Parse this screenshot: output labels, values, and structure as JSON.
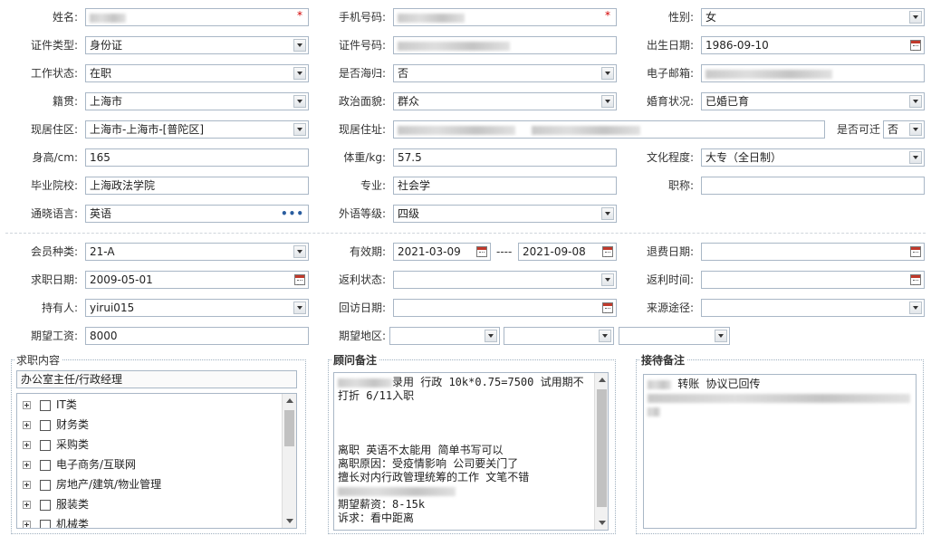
{
  "form": {
    "name": {
      "label": "姓名:"
    },
    "phone": {
      "label": "手机号码:"
    },
    "gender": {
      "label": "性别:",
      "value": "女"
    },
    "id_type": {
      "label": "证件类型:",
      "value": "身份证"
    },
    "id_no": {
      "label": "证件号码:"
    },
    "birth": {
      "label": "出生日期:",
      "value": "1986-09-10"
    },
    "work_status": {
      "label": "工作状态:",
      "value": "在职"
    },
    "overseas": {
      "label": "是否海归:",
      "value": "否"
    },
    "email": {
      "label": "电子邮箱:"
    },
    "native": {
      "label": "籍贯:",
      "value": "上海市"
    },
    "politics": {
      "label": "政治面貌:",
      "value": "群众"
    },
    "marital": {
      "label": "婚育状况:",
      "value": "已婚已育"
    },
    "residence_area": {
      "label": "现居住区:",
      "value": "上海市-上海市-[普陀区]"
    },
    "residence_addr": {
      "label": "现居住址:"
    },
    "relocate": {
      "label": "是否可迁",
      "value": "否"
    },
    "height": {
      "label": "身高/cm:",
      "value": "165"
    },
    "weight": {
      "label": "体重/kg:",
      "value": "57.5"
    },
    "education": {
      "label": "文化程度:",
      "value": "大专（全日制）"
    },
    "school": {
      "label": "毕业院校:",
      "value": "上海政法学院"
    },
    "major": {
      "label": "专业:",
      "value": "社会学"
    },
    "title": {
      "label": "职称:",
      "value": ""
    },
    "language": {
      "label": "通晓语言:",
      "value": "英语"
    },
    "lang_level": {
      "label": "外语等级:",
      "value": "四级"
    }
  },
  "membership": {
    "member_type": {
      "label": "会员种类:",
      "value": "21-A"
    },
    "validity": {
      "label": "有效期:",
      "start": "2021-03-09",
      "sep": "----",
      "end": "2021-09-08"
    },
    "refund_date": {
      "label": "退费日期:",
      "value": ""
    },
    "job_date": {
      "label": "求职日期:",
      "value": "2009-05-01"
    },
    "rebate_status": {
      "label": "返利状态:",
      "value": ""
    },
    "rebate_time": {
      "label": "返利时间:",
      "value": ""
    },
    "holder": {
      "label": "持有人:",
      "value": "yirui015"
    },
    "visit_date": {
      "label": "回访日期:",
      "value": ""
    },
    "source": {
      "label": "来源途径:",
      "value": ""
    },
    "salary": {
      "label": "期望工资:",
      "value": "8000"
    },
    "region": {
      "label": "期望地区:"
    }
  },
  "job_panel": {
    "title": "求职内容",
    "selected": "办公室主任/行政经理",
    "items": [
      "IT类",
      "财务类",
      "采购类",
      "电子商务/互联网",
      "房地产/建筑/物业管理",
      "服装类",
      "机械类"
    ]
  },
  "advisor_panel": {
    "title": "顾问备注",
    "lines": [
      "录用  行政  10k*0.75=7500  试用期不",
      "打折  6/11入职",
      "",
      "",
      "",
      "离职 英语不太能用 简单书写可以",
      "离职原因：受疫情影响 公司要关门了",
      "擅长对内行政管理统筹的工作 文笔不错",
      "",
      "期望薪资：8-15k",
      "诉求：看中距离"
    ]
  },
  "reception_panel": {
    "title": "接待备注",
    "line1": "转账 协议已回传"
  },
  "colors": {
    "border": "#a9b7c6",
    "required": "#d40000",
    "dots": "#2a5d9f"
  }
}
